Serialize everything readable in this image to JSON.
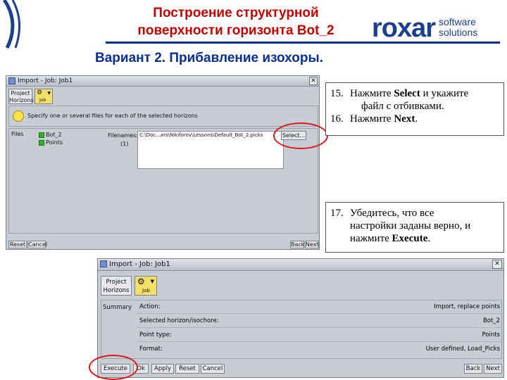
{
  "slide": {
    "title_line1": "Построение структурной",
    "title_line2": "поверхности горизонта Bot_2",
    "subtitle": "Вариант 2. Прибавление изохоры.",
    "logo_word": "roxar",
    "logo_sub1": "software",
    "logo_sub2": "solutions"
  },
  "window1": {
    "title": "Import  - Job: Job1",
    "project_btn_l1": "Project",
    "project_btn_l2": "Horizons",
    "job_label": "Job",
    "instruction": "Specify one or several files for each of the selected horizons",
    "files_label": "Files",
    "horizons": [
      "Bot_2",
      "Points"
    ],
    "filenames_label": "Filenames:",
    "filename_value": "C:\\Doc...ars\\Nikiforov\\Lessons\\Default_Bot_2.picks",
    "filename_index": "(1)",
    "select_btn": "Select...",
    "reset_btn": "Reset",
    "cancel_btn": "Cancel",
    "back_btn": "Back",
    "next_btn": "Next"
  },
  "instructions1": {
    "items": [
      {
        "num": "15.",
        "text_a": "Нажмите ",
        "bold_a": "Select",
        "text_b": " и укажите",
        "line2": "файл с отбивками."
      },
      {
        "num": "16.",
        "text_a": "Нажмите ",
        "bold_a": "Next",
        "text_b": "."
      }
    ]
  },
  "instructions2": {
    "num": "17.",
    "line1": "Убедитесь, что все",
    "line2": "настройки заданы верно, и",
    "line3_a": "нажмите ",
    "line3_bold": "Execute",
    "line3_b": "."
  },
  "window2": {
    "title": "Import  - Job: Job1",
    "project_btn_l1": "Project",
    "project_btn_l2": "Horizons",
    "job_label": "Job",
    "summary_label": "Summary",
    "rows": [
      {
        "key": "Action:",
        "value": "Import, replace points"
      },
      {
        "key": "Selected horizon/isochore:",
        "value": "Bot_2"
      },
      {
        "key": "Point type:",
        "value": "Points"
      },
      {
        "key": "Format:",
        "value": "User defined, Load_Picks"
      }
    ],
    "execute_btn": "Execute",
    "ok_btn": "Ok",
    "apply_btn": "Apply",
    "reset_btn": "Reset",
    "cancel_btn": "Cancel",
    "back_btn": "Back",
    "next_btn": "Next"
  },
  "colors": {
    "title_red": "#c00000",
    "accent_blue": "#0a2f8f",
    "highlight_red": "#d81818"
  }
}
